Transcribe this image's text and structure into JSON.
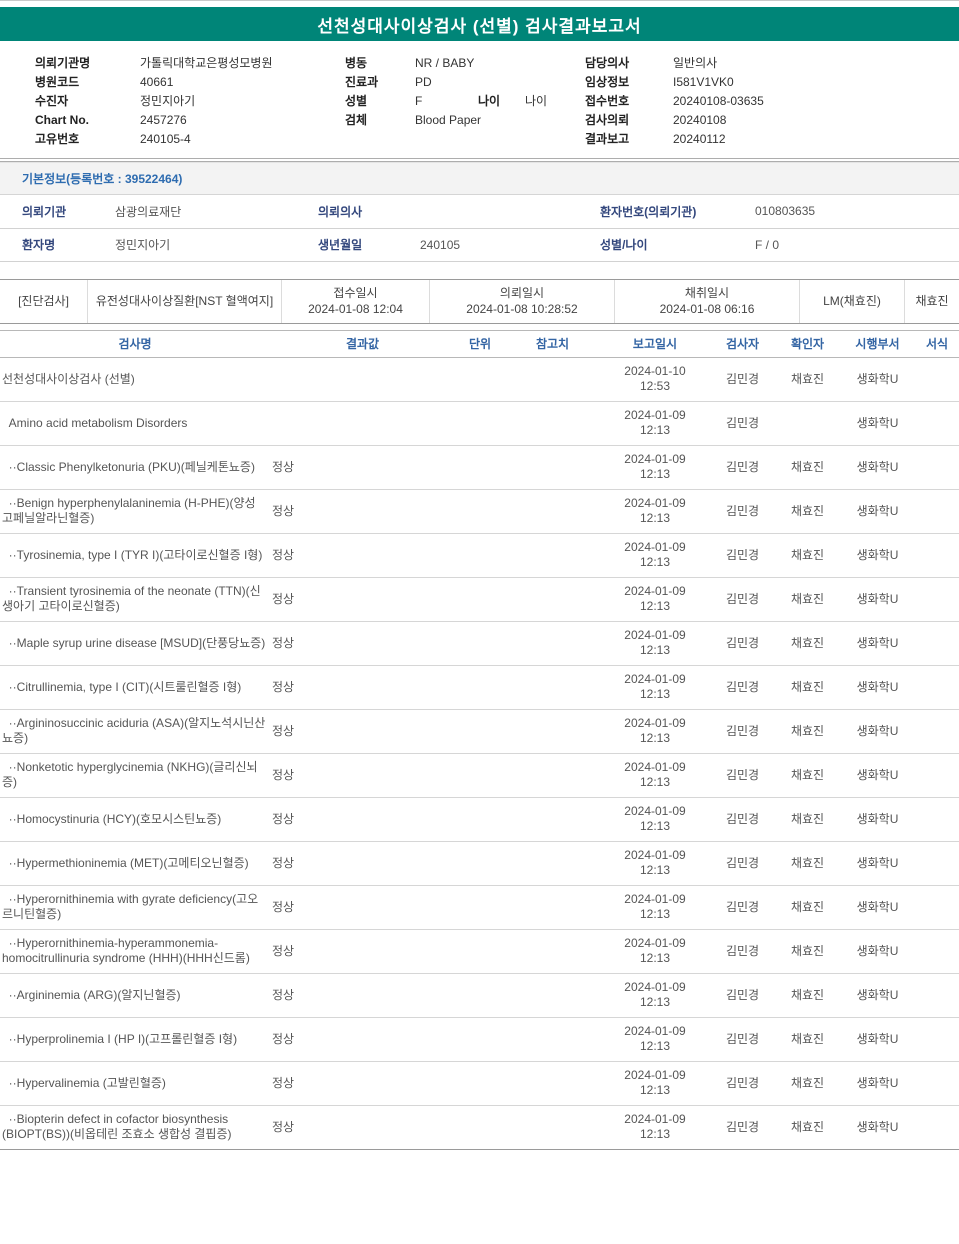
{
  "title": "선천성대사이상검사 (선별) 검사결과보고서",
  "colors": {
    "accent_teal": "#008578",
    "table_header_blue": "#3465a4",
    "label_navy": "#33477d",
    "section_title_blue": "#2e6cb0"
  },
  "header": {
    "left": [
      {
        "label": "의뢰기관명",
        "value": "가톨릭대학교은평성모병원"
      },
      {
        "label": "병원코드",
        "value": "40661"
      },
      {
        "label": "수진자",
        "value": "정민지아기"
      },
      {
        "label": "Chart No.",
        "value": "2457276"
      },
      {
        "label": "고유번호",
        "value": "240105-4"
      }
    ],
    "middle": [
      {
        "label": "병동",
        "value": "NR / BABY"
      },
      {
        "label": "진료과",
        "value": "PD"
      },
      {
        "label": "성별",
        "value": "F",
        "age_label": "나이",
        "age_value": "나이"
      },
      {
        "label": "검체",
        "value": "Blood Paper"
      }
    ],
    "right": [
      {
        "label": "담당의사",
        "value": "일반의사"
      },
      {
        "label": "임상정보",
        "value": "I581V1VK0"
      },
      {
        "label": "접수번호",
        "value": "20240108-03635"
      },
      {
        "label": "검사의뢰",
        "value": "20240108"
      },
      {
        "label": "결과보고",
        "value": "20240112"
      }
    ]
  },
  "basic_info": {
    "section_title": "기본정보(등록번호 : 39522464)",
    "row1": {
      "label1": "의뢰기관",
      "value1": "삼광의료재단",
      "label2": "의뢰의사",
      "value2": "",
      "label3": "환자번호(의뢰기관)",
      "value3": "010803635"
    },
    "row2": {
      "label1": "환자명",
      "value1": "정민지아기",
      "label2": "생년월일",
      "value2": "240105",
      "label3": "성별/나이",
      "value3": "F / 0"
    }
  },
  "order": {
    "tag": "[진단검사]",
    "name": "유전성대사이상질환[NST 혈액여지]",
    "columns": [
      {
        "label": "접수일시",
        "value": "2024-01-08 12:04"
      },
      {
        "label": "의뢰일시",
        "value": "2024-01-08 10:28:52"
      },
      {
        "label": "채취일시",
        "value": "2024-01-08 06:16"
      }
    ],
    "collector": "LM(채효진)",
    "collector2": "채효진"
  },
  "results": {
    "headers": [
      "검사명",
      "결과값",
      "단위",
      "참고치",
      "보고일시",
      "검사자",
      "확인자",
      "시행부서",
      "서식"
    ],
    "rows": [
      {
        "name": "선천성대사이상검사 (선별)",
        "result": "",
        "unit": "",
        "ref": "",
        "date": "2024-01-10\n12:53",
        "tester": "김민경",
        "confirmer": "채효진",
        "dept": "생화학U",
        "format": ""
      },
      {
        "name": "  Amino acid metabolism Disorders",
        "result": "",
        "unit": "",
        "ref": "",
        "date": "2024-01-09\n12:13",
        "tester": "김민경",
        "confirmer": "",
        "dept": "생화학U",
        "format": ""
      },
      {
        "name": "  ··Classic Phenylketonuria (PKU)(페닐케톤뇨증)",
        "result": "정상",
        "unit": "",
        "ref": "",
        "date": "2024-01-09\n12:13",
        "tester": "김민경",
        "confirmer": "채효진",
        "dept": "생화학U",
        "format": ""
      },
      {
        "name": "  ··Benign hyperphenylalaninemia (H-PHE)(양성 고페닐알라닌혈증)",
        "result": "정상",
        "unit": "",
        "ref": "",
        "date": "2024-01-09\n12:13",
        "tester": "김민경",
        "confirmer": "채효진",
        "dept": "생화학U",
        "format": ""
      },
      {
        "name": "  ··Tyrosinemia, type I (TYR I)(고타이로신혈증 I형)",
        "result": "정상",
        "unit": "",
        "ref": "",
        "date": "2024-01-09\n12:13",
        "tester": "김민경",
        "confirmer": "채효진",
        "dept": "생화학U",
        "format": ""
      },
      {
        "name": "  ··Transient tyrosinemia of the neonate (TTN)(신생아기 고타이로신혈증)",
        "result": "정상",
        "unit": "",
        "ref": "",
        "date": "2024-01-09\n12:13",
        "tester": "김민경",
        "confirmer": "채효진",
        "dept": "생화학U",
        "format": ""
      },
      {
        "name": "  ··Maple syrup urine disease [MSUD](단풍당뇨증)",
        "result": "정상",
        "unit": "",
        "ref": "",
        "date": "2024-01-09\n12:13",
        "tester": "김민경",
        "confirmer": "채효진",
        "dept": "생화학U",
        "format": ""
      },
      {
        "name": "  ··Citrullinemia, type I (CIT)(시트룰린혈증 I형)",
        "result": "정상",
        "unit": "",
        "ref": "",
        "date": "2024-01-09\n12:13",
        "tester": "김민경",
        "confirmer": "채효진",
        "dept": "생화학U",
        "format": ""
      },
      {
        "name": "  ··Argininosuccinic aciduria (ASA)(알지노석시닌산뇨증)",
        "result": "정상",
        "unit": "",
        "ref": "",
        "date": "2024-01-09\n12:13",
        "tester": "김민경",
        "confirmer": "채효진",
        "dept": "생화학U",
        "format": ""
      },
      {
        "name": "  ··Nonketotic hyperglycinemia (NKHG)(글리신뇌증)",
        "result": "정상",
        "unit": "",
        "ref": "",
        "date": "2024-01-09\n12:13",
        "tester": "김민경",
        "confirmer": "채효진",
        "dept": "생화학U",
        "format": ""
      },
      {
        "name": "  ··Homocystinuria (HCY)(호모시스틴뇨증)",
        "result": "정상",
        "unit": "",
        "ref": "",
        "date": "2024-01-09\n12:13",
        "tester": "김민경",
        "confirmer": "채효진",
        "dept": "생화학U",
        "format": ""
      },
      {
        "name": "  ··Hypermethioninemia (MET)(고메티오닌혈증)",
        "result": "정상",
        "unit": "",
        "ref": "",
        "date": "2024-01-09\n12:13",
        "tester": "김민경",
        "confirmer": "채효진",
        "dept": "생화학U",
        "format": ""
      },
      {
        "name": "  ··Hyperornithinemia with gyrate deficiency(고오르니틴혈증)",
        "result": "정상",
        "unit": "",
        "ref": "",
        "date": "2024-01-09\n12:13",
        "tester": "김민경",
        "confirmer": "채효진",
        "dept": "생화학U",
        "format": ""
      },
      {
        "name": "  ··Hyperornithinemia-hyperammonemia-homocitrullinuria syndrome (HHH)(HHH신드롬)",
        "result": "정상",
        "unit": "",
        "ref": "",
        "date": "2024-01-09\n12:13",
        "tester": "김민경",
        "confirmer": "채효진",
        "dept": "생화학U",
        "format": ""
      },
      {
        "name": "  ··Argininemia (ARG)(알지닌혈증)",
        "result": "정상",
        "unit": "",
        "ref": "",
        "date": "2024-01-09\n12:13",
        "tester": "김민경",
        "confirmer": "채효진",
        "dept": "생화학U",
        "format": ""
      },
      {
        "name": "  ··Hyperprolinemia I (HP I)(고프롤린혈증 I형)",
        "result": "정상",
        "unit": "",
        "ref": "",
        "date": "2024-01-09\n12:13",
        "tester": "김민경",
        "confirmer": "채효진",
        "dept": "생화학U",
        "format": ""
      },
      {
        "name": "  ··Hypervalinemia (고발린혈증)",
        "result": "정상",
        "unit": "",
        "ref": "",
        "date": "2024-01-09\n12:13",
        "tester": "김민경",
        "confirmer": "채효진",
        "dept": "생화학U",
        "format": ""
      },
      {
        "name": "  ··Biopterin defect in cofactor biosynthesis (BIOPT(BS))(비옵테린 조효소 생합성 결핍증)",
        "result": "정상",
        "unit": "",
        "ref": "",
        "date": "2024-01-09\n12:13",
        "tester": "김민경",
        "confirmer": "채효진",
        "dept": "생화학U",
        "format": ""
      }
    ]
  }
}
